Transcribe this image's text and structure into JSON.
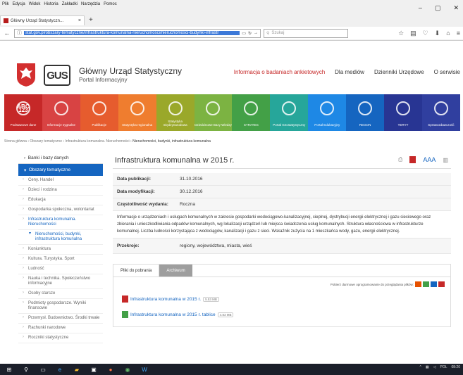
{
  "browser": {
    "menu": [
      "Plik",
      "Edycja",
      "Widok",
      "Historia",
      "Zakładki",
      "Narzędzia",
      "Pomoc"
    ],
    "tab_title": "Główny Urząd Statystyczn...",
    "url": "stat.gov.pl/obszary-tematyczne/infrastruktura-komunalna-nieruchomosci/nieruchomosci-budynki-infrastr",
    "search_placeholder": "Szukaj"
  },
  "header": {
    "logo_text": "GUS",
    "org_name": "Główny Urząd Statystyczny",
    "org_sub": "Portal Informacyjny",
    "nav": [
      "Informacja o badaniach ankietowych",
      "Dla mediów",
      "Dzienniki Urzędowe",
      "O serwisie"
    ]
  },
  "tiles": [
    {
      "label": "Podstawowe dane",
      "icon": "ABC 123",
      "color": "#c62828"
    },
    {
      "label": "Informacje sygnalne",
      "icon": "chat-icon",
      "color": "#d84343"
    },
    {
      "label": "Publikacje",
      "icon": "book-icon",
      "color": "#e65c2e"
    },
    {
      "label": "Statystyka regionalna",
      "icon": "regions-icon",
      "color": "#ef7d2f"
    },
    {
      "label": "Statystyka międzynarodowa",
      "icon": "globe-icon",
      "color": "#9aa82a"
    },
    {
      "label": "Dziedzinowe Bazy Wiedzy",
      "icon": "database-icon",
      "color": "#7cb342"
    },
    {
      "label": "STRATEG",
      "icon": "layers-icon",
      "color": "#43a047"
    },
    {
      "label": "Portal Geostatystyczny",
      "icon": "map-icon",
      "color": "#26a69a"
    },
    {
      "label": "Portal Edukacyjny",
      "icon": "monitor-icon",
      "color": "#1e88e5"
    },
    {
      "label": "REGON",
      "icon": "document-icon",
      "color": "#1565c0"
    },
    {
      "label": "TERYT",
      "icon": "location-icon",
      "color": "#283593"
    },
    {
      "label": "Sprawozdawczość",
      "icon": "chart-icon",
      "color": "#303f9f"
    }
  ],
  "breadcrumb": [
    "Strona główna",
    "Obszary tematyczne",
    "Infrastruktura komunalna. Nieruchomości",
    "Nieruchomości, budynki, infrastruktura komunalna"
  ],
  "sidebar": {
    "top": "Banki i bazy danych",
    "active": "Obszary tematyczne",
    "items": [
      {
        "label": "Ceny. Handel"
      },
      {
        "label": "Dzieci i rodzina"
      },
      {
        "label": "Edukacja"
      },
      {
        "label": "Gospodarka społeczna, wolontariat"
      },
      {
        "label": "Infrastruktura komunalna. Nieruchomości",
        "open": true
      },
      {
        "label": "Nieruchomości, budynki, infrastruktura komunalna",
        "sub": true
      },
      {
        "label": "Koniunktura"
      },
      {
        "label": "Kultura. Turystyka. Sport"
      },
      {
        "label": "Ludność"
      },
      {
        "label": "Nauka i technika. Społeczeństwo informacyjne"
      },
      {
        "label": "Osoby starsze"
      },
      {
        "label": "Podmioty gospodarcze. Wyniki finansowe"
      },
      {
        "label": "Przemysł. Budownictwo. Środki trwałe"
      },
      {
        "label": "Rachunki narodowe"
      },
      {
        "label": "Roczniki statystyczne"
      }
    ]
  },
  "main": {
    "title": "Infrastruktura komunalna w 2015 r.",
    "font_size_label": "AAA",
    "rows": [
      {
        "label": "Data publikacji:",
        "value": "31.10.2016"
      },
      {
        "label": "Data modyfikacji:",
        "value": "30.12.2016"
      },
      {
        "label": "Częstotliwość wydania:",
        "value": "Roczna"
      }
    ],
    "description": "Informacje o urządzeniach i usługach komunalnych w zakresie gospodarki wodociągowo-kanalizacyjnej, cieplnej, dystrybucji energii elektrycznej i gazu sieciowego oraz zbierania i unieszkodliwiania odpadów komunalnych, wg lokalizacji urządzeń lub miejsca świadczenia usług komunalnych. Struktura własnościowa w infrastrukturze komunalnej. Liczba ludności korzystająca z wodociągów, kanalizacji i gazu z sieci. Wskaźnik zużycia na 1 mieszkańca wody, gazu, energii elektrycznej.",
    "przekroje_label": "Przekroje:",
    "przekroje_value": "regiony, województwa, miasta, wieś",
    "tab_files": "Pliki do pobrania",
    "tab_archive": "Archiwum",
    "free_software": "Pobierz darmowe oprogramowanie do przeglądania plików:",
    "files": [
      {
        "name": "Infrastruktura komunalna w 2015 r.",
        "size": "5.53 MB",
        "color": "#c62828"
      },
      {
        "name": "Infrastruktura komunalna w 2015 r. tablice",
        "size": "4.83 MB",
        "color": "#43a047"
      }
    ]
  },
  "taskbar": {
    "lang": "POL",
    "time": "08:20"
  }
}
